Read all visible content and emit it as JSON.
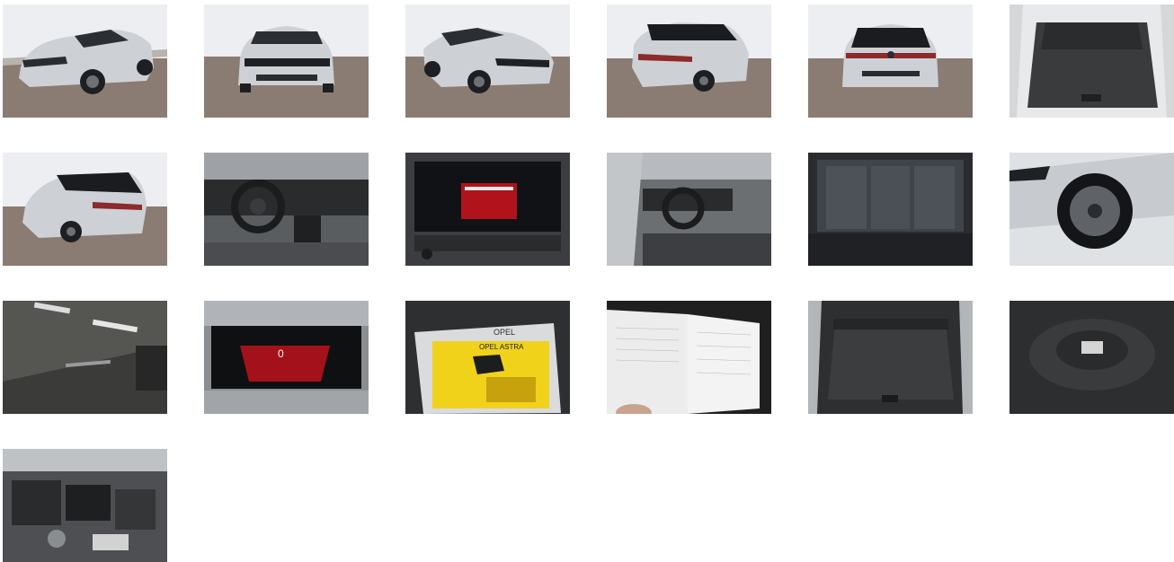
{
  "gallery": {
    "photos": [
      {
        "subject": "exterior-front-left",
        "view": "studio"
      },
      {
        "subject": "exterior-front",
        "view": "studio"
      },
      {
        "subject": "exterior-front-right",
        "view": "studio"
      },
      {
        "subject": "exterior-rear-right",
        "view": "studio"
      },
      {
        "subject": "exterior-rear",
        "view": "studio"
      },
      {
        "subject": "cargo-area-open",
        "view": "interior"
      },
      {
        "subject": "exterior-rear-left",
        "view": "studio"
      },
      {
        "subject": "cockpit-steering-wheel",
        "view": "interior"
      },
      {
        "subject": "infotainment-screen",
        "view": "interior"
      },
      {
        "subject": "cockpit-from-door",
        "view": "interior"
      },
      {
        "subject": "rear-seats",
        "view": "interior"
      },
      {
        "subject": "wheel-and-headlight",
        "view": "detail"
      },
      {
        "subject": "windshield-badge",
        "view": "detail"
      },
      {
        "subject": "digital-instrument-cluster",
        "view": "interior"
      },
      {
        "subject": "owners-manual-and-key",
        "view": "detail"
      },
      {
        "subject": "service-booklet",
        "view": "detail"
      },
      {
        "subject": "cargo-area-cover",
        "view": "interior"
      },
      {
        "subject": "spare-wheel-well",
        "view": "interior"
      },
      {
        "subject": "engine-bay",
        "view": "detail"
      }
    ]
  },
  "screens": {
    "infotainment_value": "",
    "cluster_speed": "0"
  },
  "manual": {
    "brand": "OPEL",
    "model": "OPEL ASTRA"
  },
  "colors": {
    "car_body": "#c9cdd1",
    "studio_wall": "#eceef2",
    "studio_floor": "#8a7c72",
    "interior_dark": "#2a2b2d",
    "screen_red": "#b0131c",
    "brand_yellow": "#f3c300"
  }
}
